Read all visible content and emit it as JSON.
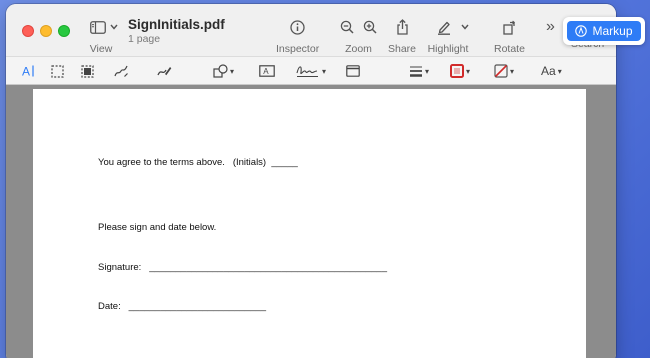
{
  "document": {
    "name": "SignInitials.pdf",
    "subtitle": "1 page"
  },
  "toolbar": {
    "view_label": "View",
    "inspector_label": "Inspector",
    "zoom_label": "Zoom",
    "share_label": "Share",
    "highlight_label": "Highlight",
    "rotate_label": "Rotate",
    "search_label": "Search",
    "more_label": "»",
    "markup_label": "Markup"
  },
  "markup_tools": {
    "text_style_label": "Aa"
  },
  "colors": {
    "accent": "#2e7cf6",
    "desktop": "#5577dd"
  },
  "page": {
    "line1": "You agree to the terms above.   (Initials)  _____",
    "line2": "Please sign and date below.",
    "signature_label": "Signature:",
    "signature_blank": "_____________________________________________",
    "date_label": "Date:",
    "date_blank": "__________________________"
  }
}
